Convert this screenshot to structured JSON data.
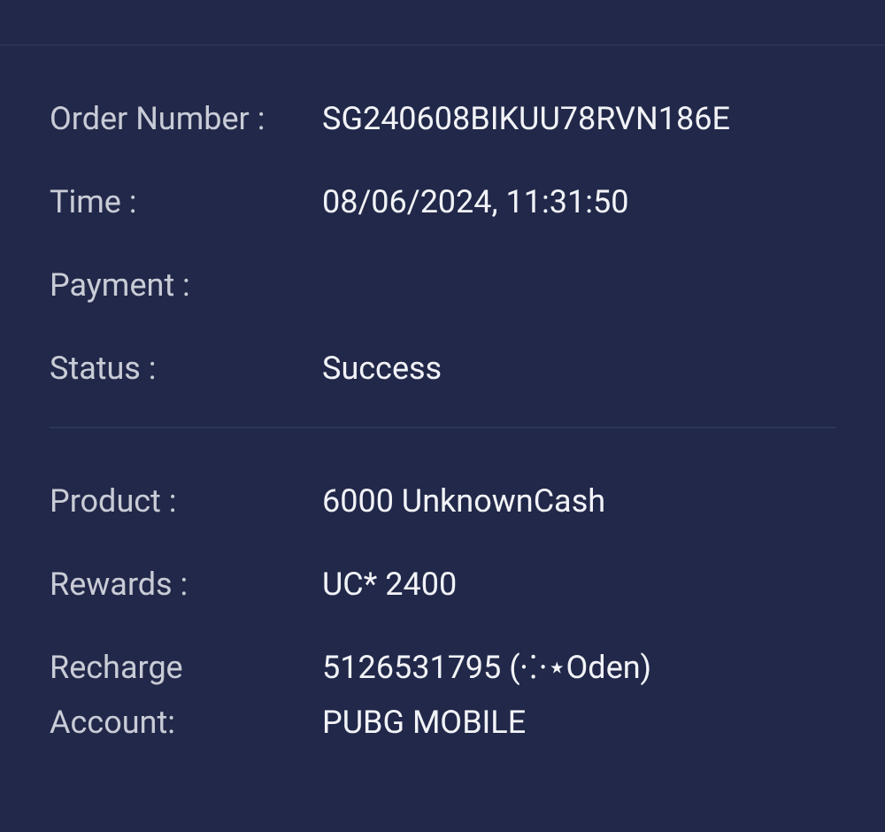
{
  "sections": [
    {
      "rows": [
        {
          "label": [
            "Order Number :"
          ],
          "value": [
            "SG240608BIKUU78RVN186E"
          ]
        },
        {
          "label": [
            "Time :"
          ],
          "value": [
            "08/06/2024, 11:31:50"
          ]
        },
        {
          "label": [
            "Payment :"
          ],
          "value": []
        },
        {
          "label": [
            "Status :"
          ],
          "value": [
            "Success"
          ]
        }
      ]
    },
    {
      "rows": [
        {
          "label": [
            "Product :"
          ],
          "value": [
            "6000 UnknownCash"
          ]
        },
        {
          "label": [
            "Rewards :"
          ],
          "value": [
            "UC* 2400"
          ]
        },
        {
          "label": [
            "Recharge",
            "Account:"
          ],
          "value": [
            "5126531795 (⁘⋆Oden)",
            "PUBG MOBILE"
          ]
        }
      ]
    }
  ]
}
